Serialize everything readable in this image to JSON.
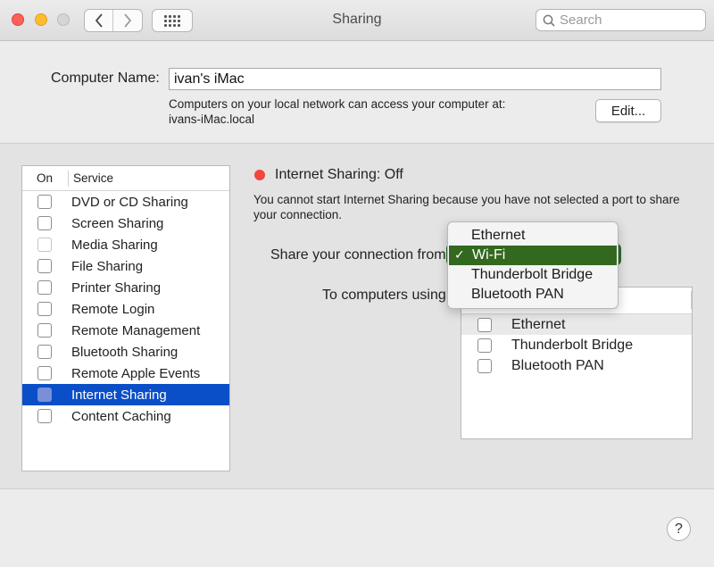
{
  "window": {
    "title": "Sharing"
  },
  "search": {
    "placeholder": "Search"
  },
  "computer_name": {
    "label": "Computer Name:",
    "value": "ivan's iMac",
    "info_line1": "Computers on your local network can access your computer at:",
    "info_line2": "ivans-iMac.local",
    "edit_label": "Edit..."
  },
  "services": {
    "header_on": "On",
    "header_service": "Service",
    "items": [
      {
        "label": "DVD or CD Sharing",
        "checked": false,
        "enabled": true
      },
      {
        "label": "Screen Sharing",
        "checked": false,
        "enabled": true
      },
      {
        "label": "Media Sharing",
        "checked": false,
        "enabled": false
      },
      {
        "label": "File Sharing",
        "checked": false,
        "enabled": true
      },
      {
        "label": "Printer Sharing",
        "checked": false,
        "enabled": true
      },
      {
        "label": "Remote Login",
        "checked": false,
        "enabled": true
      },
      {
        "label": "Remote Management",
        "checked": false,
        "enabled": true
      },
      {
        "label": "Bluetooth Sharing",
        "checked": false,
        "enabled": true
      },
      {
        "label": "Remote Apple Events",
        "checked": false,
        "enabled": true
      },
      {
        "label": "Internet Sharing",
        "checked": false,
        "enabled": true,
        "selected": true
      },
      {
        "label": "Content Caching",
        "checked": false,
        "enabled": true
      }
    ]
  },
  "detail": {
    "status": "Internet Sharing: Off",
    "status_color": "#f3443e",
    "description": "You cannot start Internet Sharing because you have not selected a port to share your connection.",
    "share_from_label": "Share your connection from:",
    "to_computers_label": "To computers using:",
    "popup_menu": {
      "items": [
        "Ethernet",
        "Wi-Fi",
        "Thunderbolt Bridge",
        "Bluetooth PAN"
      ],
      "selected": "Wi-Fi",
      "check_mark": "✓"
    },
    "ports": [
      {
        "label": "Ethernet",
        "checked": false
      },
      {
        "label": "Thunderbolt Bridge",
        "checked": false
      },
      {
        "label": "Bluetooth PAN",
        "checked": false
      }
    ]
  },
  "help": {
    "label": "?"
  },
  "colors": {
    "selection": "#0a4fc7",
    "menu_highlight": "#33691e"
  }
}
